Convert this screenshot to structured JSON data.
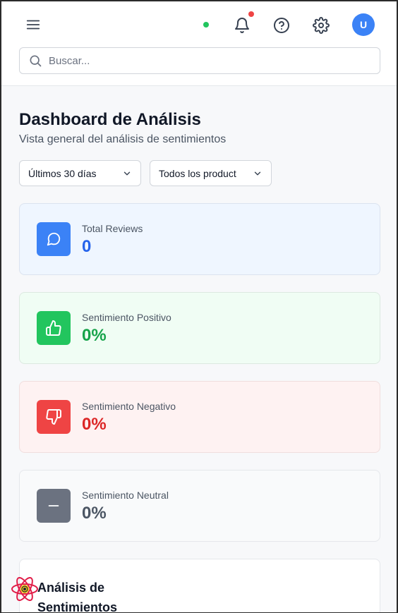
{
  "header": {
    "avatar_initial": "U",
    "search_placeholder": "Buscar...",
    "online_status_color": "#22c55e",
    "notification_dot_color": "#ef4444"
  },
  "page": {
    "title": "Dashboard de Análisis",
    "subtitle": "Vista general del análisis de sentimientos"
  },
  "filters": {
    "date_range": "Últimos 30 días",
    "product": "Todos los product"
  },
  "stats": [
    {
      "label": "Total Reviews",
      "value": "0",
      "icon": "message-circle-icon",
      "color": "#3b82f6"
    },
    {
      "label": "Sentimiento Positivo",
      "value": "0%",
      "icon": "thumbs-up-icon",
      "color": "#22c55e"
    },
    {
      "label": "Sentimiento Negativo",
      "value": "0%",
      "icon": "thumbs-down-icon",
      "color": "#ef4444"
    },
    {
      "label": "Sentimiento Neutral",
      "value": "0%",
      "icon": "minus-icon",
      "color": "#6b7280"
    }
  ],
  "analysis": {
    "title": "Análisis de Sentimientos"
  }
}
